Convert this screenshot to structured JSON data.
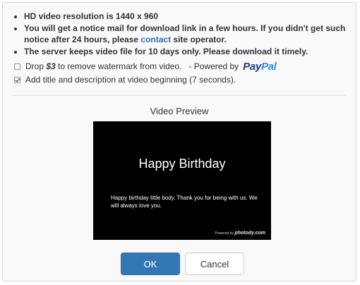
{
  "notes": {
    "line1": "HD video resolution is 1440 x 960",
    "line2_pre": "You will get a notice mail for download link in a few hours. If you didn't get such notice after 24 hours, please ",
    "line2_link": "contact",
    "line2_post": " site operator.",
    "line3": "The server keeps video file for 10 days only. Please download it timely."
  },
  "options": {
    "watermark": {
      "checked": false,
      "pre": "Drop ",
      "price": "$3",
      "post": " to remove watermark from video.   - Powered by",
      "paypal_pay": "Pay",
      "paypal_pal": "Pal"
    },
    "title_desc": {
      "checked": true,
      "label": "Add title and description at video beginning (7 seconds)."
    }
  },
  "preview": {
    "heading": "Video Preview",
    "video_title": "Happy Birthday",
    "video_description": "Happy birthday little body. Thank you for being with us. We will always love you.",
    "watermark_prefix": "Powered by",
    "watermark_brand": "photody.com"
  },
  "buttons": {
    "ok": "OK",
    "cancel": "Cancel"
  },
  "colors": {
    "ok_button": "#3378b5",
    "link": "#2a6fb5",
    "video_bg": "#000000"
  }
}
